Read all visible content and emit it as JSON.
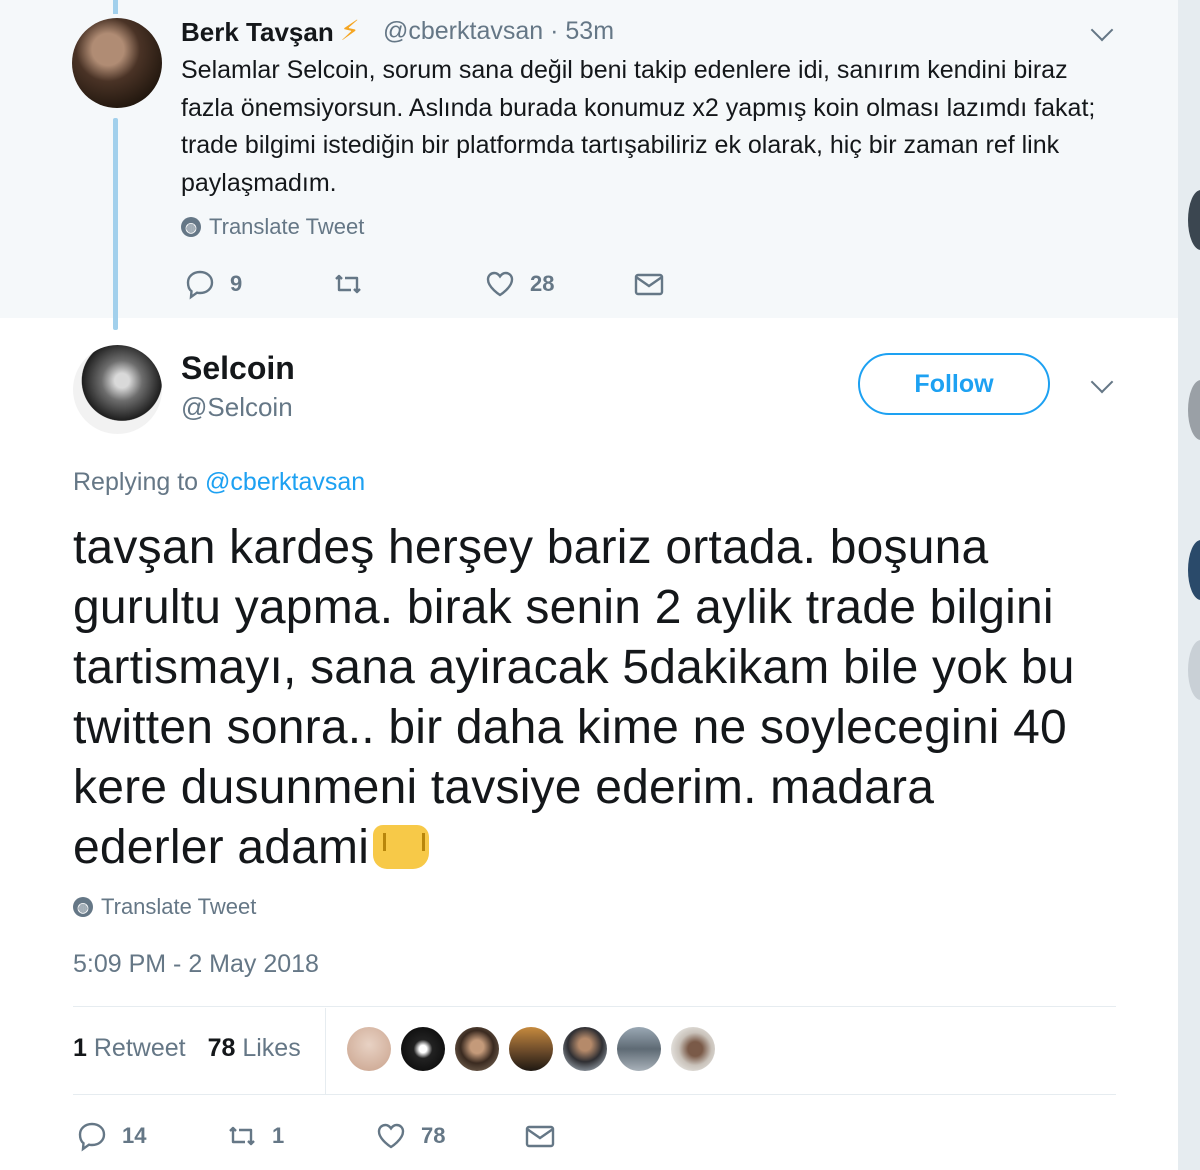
{
  "parent_tweet": {
    "name": "Berk Tavşan",
    "handle_time": "@cberktavsan · 53m",
    "text": "Selamlar Selcoin, sorum sana değil beni takip edenlere idi, sanırım kendini biraz fazla önemsiyorsun. Aslında burada konumuz x2 yapmış koin olması lazımdı fakat; trade bilgimi istediğin bir platformda tartışabiliriz ek olarak, hiç bir zaman ref link paylaşmadım.",
    "translate": "Translate Tweet",
    "replies": "9",
    "retweets": "",
    "likes": "28"
  },
  "main_tweet": {
    "name": "Selcoin",
    "handle": "@Selcoin",
    "follow": "Follow",
    "replying_prefix": "Replying to",
    "replying_handle": "@cberktavsan",
    "text": "tavşan kardeş herşey bariz ortada. boşuna gurultu yapma. birak senin 2 aylik trade bilgini tartismayı, sana ayiracak 5dakikam bile yok bu twitten sonra.. bir daha kime ne soylecegini 40 kere dusunmeni tavsiye ederim. madara ederler adami",
    "translate": "Translate Tweet",
    "timestamp": "5:09 PM - 2 May 2018",
    "retweet_count": "1",
    "retweet_label": "Retweet",
    "like_count": "78",
    "like_label": "Likes",
    "replies": "14",
    "retweets": "1",
    "likes": "78"
  },
  "icons": {
    "reply": "reply-icon",
    "retweet": "retweet-icon",
    "like": "heart-icon",
    "dm": "envelope-icon",
    "globe": "globe-icon",
    "bolt": "lightning-emoji",
    "fist": "fist-emoji"
  },
  "colors": {
    "accent": "#1da1f2",
    "muted": "#657786",
    "thread_line": "#a2d0ec",
    "parent_bg": "#f5f8fa"
  }
}
